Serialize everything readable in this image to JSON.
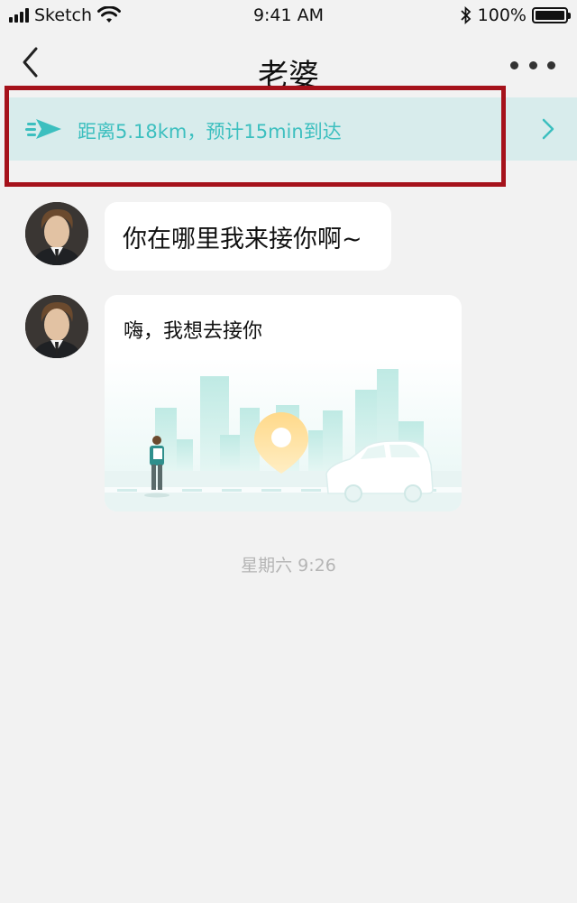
{
  "status_bar": {
    "carrier": "Sketch",
    "time": "9:41 AM",
    "battery_percent": "100%",
    "battery_level": 1.0
  },
  "nav": {
    "title": "老婆"
  },
  "banner": {
    "text": "距离5.18km，预计15min到达"
  },
  "messages": [
    {
      "type": "text",
      "text": "你在哪里我来接你啊~"
    },
    {
      "type": "card",
      "text": "嗨，我想去接你"
    }
  ],
  "timestamp": "星期六 9:26",
  "colors": {
    "accent": "#3cbfbf",
    "banner_bg": "#d8ecec",
    "highlight_border": "#a5121b",
    "page_bg": "#f2f2f2"
  }
}
